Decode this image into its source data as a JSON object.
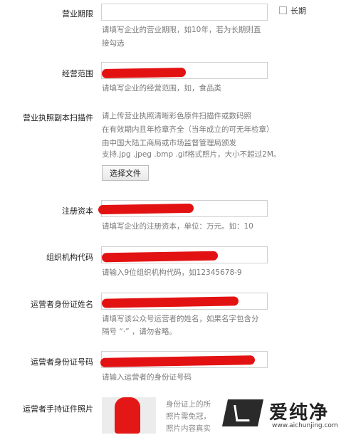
{
  "fields": {
    "term": {
      "label": "营业期限",
      "value": "",
      "checkbox_label": "长期",
      "hint1": "请填写企业的营业期限，如10年，若为长期则直",
      "hint2": "接勾选"
    },
    "scope": {
      "label": "经营范围",
      "hint": "请填写企业的经营范围，如，食品类"
    },
    "license": {
      "label": "营业执照副本扫描件",
      "hint1": "请上传营业执照清晰彩色原件扫描件或数码照",
      "hint2": "在有效期内且年检章齐全（当年成立的可无年检章）",
      "hint3": "由中国大陆工商局或市场监督管理局颁发",
      "hint4": "支持.jpg .jpeg .bmp .gif格式照片，大小不超过2M。",
      "button": "选择文件"
    },
    "capital": {
      "label": "注册资本",
      "hint": "请填写企业的注册资本，单位：万元。如：10"
    },
    "org_code": {
      "label": "组织机构代码",
      "hint": "请输入9位组织机构代码，如12345678-9"
    },
    "operator_name": {
      "label": "运营者身份证姓名",
      "hint1": "请填写该公众号运营者的姓名，如果名字包含分",
      "hint2": "隔号 “·” ，请勿省略。"
    },
    "operator_id": {
      "label": "运营者身份证号码",
      "hint": "请输入运营者的身份证号码"
    },
    "operator_photo": {
      "label": "运营者手持证件照片",
      "hint1": "身份证上的所",
      "hint2": "照片需免冠，",
      "hint3": "照片内容真实"
    }
  },
  "watermark": {
    "name": "爱纯净",
    "url": "www.aichunjing.com"
  },
  "colors": {
    "redaction": "#e31212",
    "hint_text": "#7a7a7a",
    "input_border": "#cfcfcf"
  }
}
